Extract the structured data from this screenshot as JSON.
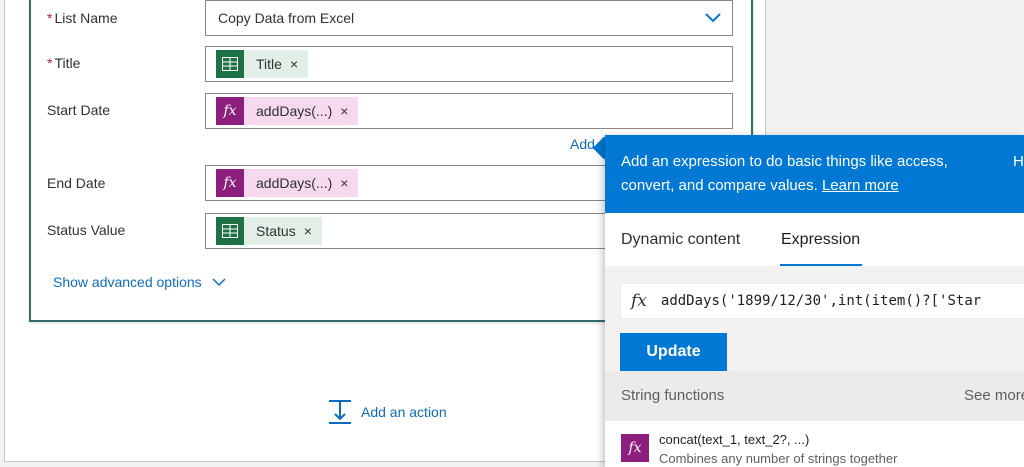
{
  "form": {
    "list_name": {
      "label": "List Name",
      "required_mark": "*",
      "value": "Copy Data from Excel",
      "icon": "chevron-down-icon"
    },
    "title": {
      "label": "Title",
      "required_mark": "*",
      "token": "Title",
      "token_icon": "excel-icon"
    },
    "start_date": {
      "label": "Start Date",
      "token": "addDays(...)",
      "token_icon": "fx-icon"
    },
    "end_date": {
      "label": "End Date",
      "token": "addDays(...)",
      "token_icon": "fx-icon"
    },
    "status_value": {
      "label": "Status Value",
      "token": "Status",
      "token_icon": "excel-icon"
    },
    "remove_glyph": "×",
    "add_dynamic_partial": "Add",
    "show_advanced": "Show advanced options"
  },
  "add_action": {
    "label": "Add an action",
    "icon": "add-action-icon"
  },
  "popup": {
    "header_text": "Add an expression to do basic things like access, convert, and compare values.",
    "header_text_line1": "Add an expression to do basic things like access,",
    "header_text_line2": "convert, and compare values.",
    "learn_more": "Learn more",
    "header_cut": "H",
    "tabs": [
      {
        "label": "Dynamic content",
        "active": false
      },
      {
        "label": "Expression",
        "active": true
      }
    ],
    "fx_glyph": "fx",
    "expression_value": "addDays('1899/12/30',int(item()?['Star",
    "update_label": "Update",
    "section_title": "String functions",
    "see_more": "See more",
    "functions": [
      {
        "name": "concat(text_1, text_2?, ...)",
        "description": "Combines any number of strings together"
      }
    ]
  },
  "colors": {
    "card_border": "#326e6e",
    "accent": "#0078d4",
    "excel": "#1e7145",
    "expression": "#8c1e7d",
    "required": "#a4262c"
  }
}
